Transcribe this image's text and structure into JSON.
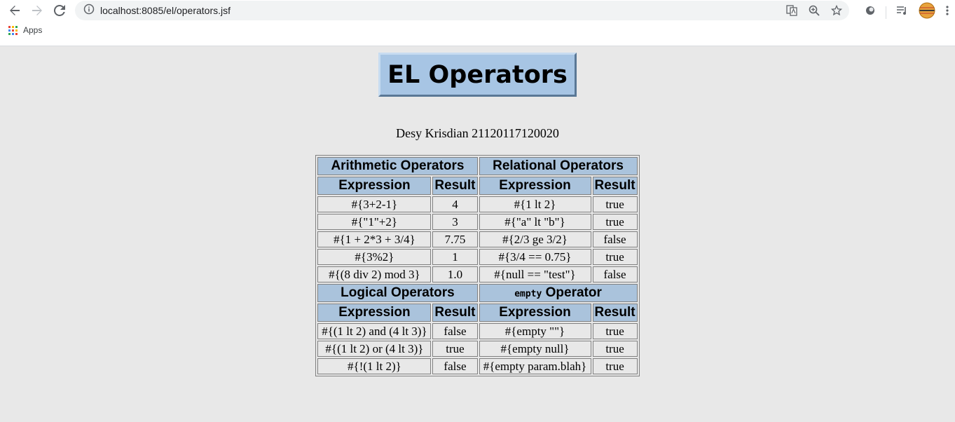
{
  "browser": {
    "url": "localhost:8085/el/operators.jsf",
    "bookmarks_apps": "Apps"
  },
  "page": {
    "title": "EL Operators",
    "author": "Desy Krisdian 21120117120020"
  },
  "sections": {
    "arithmetic": {
      "title": "Arithmetic Operators",
      "expr_header": "Expression",
      "result_header": "Result",
      "rows": [
        {
          "expr": "#{3+2-1}",
          "result": "4"
        },
        {
          "expr": "#{\"1\"+2}",
          "result": "3"
        },
        {
          "expr": "#{1 + 2*3 + 3/4}",
          "result": "7.75"
        },
        {
          "expr": "#{3%2}",
          "result": "1"
        },
        {
          "expr": "#{(8 div 2) mod 3}",
          "result": "1.0"
        }
      ]
    },
    "relational": {
      "title": "Relational Operators",
      "expr_header": "Expression",
      "result_header": "Result",
      "rows": [
        {
          "expr": "#{1 lt 2}",
          "result": "true"
        },
        {
          "expr": "#{\"a\" lt \"b\"}",
          "result": "true"
        },
        {
          "expr": "#{2/3 ge 3/2}",
          "result": "false"
        },
        {
          "expr": "#{3/4 == 0.75}",
          "result": "true"
        },
        {
          "expr": "#{null == \"test\"}",
          "result": "false"
        }
      ]
    },
    "logical": {
      "title": "Logical Operators",
      "expr_header": "Expression",
      "result_header": "Result",
      "rows": [
        {
          "expr": "#{(1 lt 2) and (4 lt 3)}",
          "result": "false"
        },
        {
          "expr": "#{(1 lt 2) or (4 lt 3)}",
          "result": "true"
        },
        {
          "expr": "#{!(1 lt 2)}",
          "result": "false"
        }
      ]
    },
    "empty": {
      "title_code": "empty",
      "title_rest": " Operator",
      "expr_header": "Expression",
      "result_header": "Result",
      "rows": [
        {
          "expr": "#{empty \"\"}",
          "result": "true"
        },
        {
          "expr": "#{empty null}",
          "result": "true"
        },
        {
          "expr": "#{empty param.blah}",
          "result": "true"
        }
      ]
    }
  },
  "colors": {
    "page_bg": "#e8e8e8",
    "header_bg": "#aac3dc",
    "title_bg": "#a7c5e4"
  }
}
